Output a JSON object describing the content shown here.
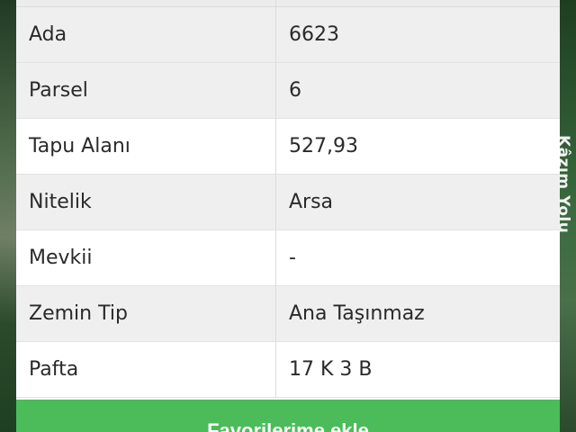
{
  "parcel_table": {
    "rows": [
      {
        "label": "Ada",
        "value": "6623"
      },
      {
        "label": "Parsel",
        "value": "6"
      },
      {
        "label": "Tapu Alanı",
        "value": "527,93"
      },
      {
        "label": "Nitelik",
        "value": "Arsa"
      },
      {
        "label": "Mevkii",
        "value": "-"
      },
      {
        "label": "Zemin Tip",
        "value": "Ana Taşınmaz"
      },
      {
        "label": "Pafta",
        "value": "17 K 3 B"
      }
    ]
  },
  "map": {
    "street_label": "Kâzım Yolu"
  },
  "action": {
    "label": "Favorilerime ekle"
  }
}
